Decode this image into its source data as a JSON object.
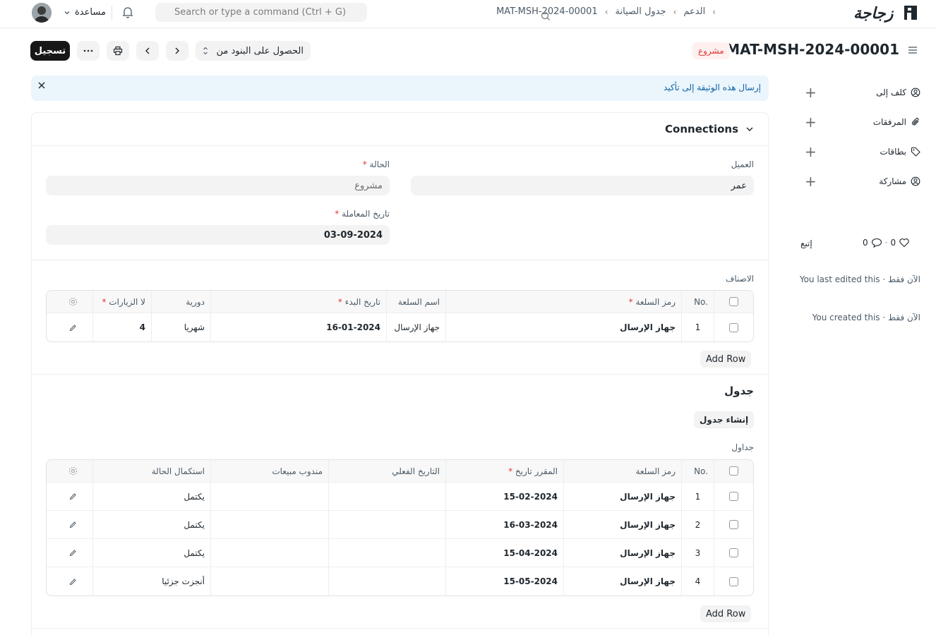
{
  "navbar": {
    "logo_text": "زجاجة",
    "breadcrumbs": [
      "الدعم",
      "جدول الصيانة",
      "MAT-MSH-2024-00001"
    ],
    "search_placeholder": "Search or type a command (Ctrl + G)",
    "help_label": "مساعدة"
  },
  "page": {
    "title": "MAT-MSH-2024-00001",
    "status": "مشروع",
    "primary_button": "تسجيل",
    "get_items_label": "الحصول على البنود من"
  },
  "sidebar": {
    "items": [
      {
        "label": "كلف إلى",
        "icon": "assign-icon"
      },
      {
        "label": "المرفقات",
        "icon": "paperclip-icon"
      },
      {
        "label": "بطاقات",
        "icon": "tag-icon"
      },
      {
        "label": "مشاركة",
        "icon": "share-icon"
      }
    ],
    "likes": "0",
    "comments": "0",
    "follow_label": "إتبع",
    "activity": [
      "You last edited this · الآن فقط",
      "You created this · الآن فقط"
    ]
  },
  "alert": {
    "message": "إرسال هذه الوثيقة إلى تأكيد"
  },
  "form": {
    "section_title": "Connections",
    "customer_label": "العميل",
    "customer_value": "عمر",
    "status_label": "الحالة",
    "status_value": "مشروع",
    "date_label": "تاريخ المعاملة",
    "date_value": "03-09-2024",
    "items_label": "الاصناف",
    "items_table": {
      "headers": [
        "No.",
        "رمز السلعة",
        "اسم السلعة",
        "تاريخ البدء",
        "دورية",
        "لا الزيارات"
      ],
      "rows": [
        {
          "no": "1",
          "item_code": "جهاز الإرسال",
          "item_name": "جهاز الإرسال",
          "start_date": "16-01-2024",
          "periodicity": "شهريا",
          "visits": "4"
        }
      ]
    },
    "add_row_label": "Add Row",
    "schedule_heading": "جدول",
    "generate_schedule_label": "إنشاء جدول",
    "schedules_label": "جداول",
    "schedule_table": {
      "headers": [
        "No.",
        "رمز السلعة",
        "المقرر تاريخ",
        "التاريخ الفعلي",
        "مندوب مبيعات",
        "استكمال الحالة"
      ],
      "rows": [
        {
          "no": "1",
          "item_code": "جهاز الإرسال",
          "scheduled": "15-02-2024",
          "actual": "",
          "sales_person": "",
          "completion": "يكتمل"
        },
        {
          "no": "2",
          "item_code": "جهاز الإرسال",
          "scheduled": "16-03-2024",
          "actual": "",
          "sales_person": "",
          "completion": "يكتمل"
        },
        {
          "no": "3",
          "item_code": "جهاز الإرسال",
          "scheduled": "15-04-2024",
          "actual": "",
          "sales_person": "",
          "completion": "يكتمل"
        },
        {
          "no": "4",
          "item_code": "جهاز الإرسال",
          "scheduled": "15-05-2024",
          "actual": "",
          "sales_person": "",
          "completion": "أنجزت جزئيا"
        }
      ]
    }
  }
}
